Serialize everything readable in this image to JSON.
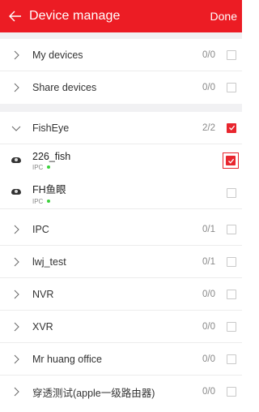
{
  "header": {
    "title": "Device manage",
    "done_label": "Done"
  },
  "groups_top": [
    {
      "label": "My devices",
      "count": "0/0",
      "checked": false
    },
    {
      "label": "Share devices",
      "count": "0/0",
      "checked": false
    }
  ],
  "fisheye": {
    "label": "FishEye",
    "count": "2/2",
    "checked": true,
    "devices": [
      {
        "name": "226_fish",
        "type": "IPC",
        "online_color": "#3bd13b",
        "checked": true
      },
      {
        "name": "FH鱼眼",
        "type": "IPC",
        "online_color": "#3bd13b",
        "checked": false
      }
    ]
  },
  "groups_bottom": [
    {
      "label": "IPC",
      "count": "0/1",
      "checked": false
    },
    {
      "label": "lwj_test",
      "count": "0/1",
      "checked": false
    },
    {
      "label": "NVR",
      "count": "0/0",
      "checked": false
    },
    {
      "label": "XVR",
      "count": "0/0",
      "checked": false
    },
    {
      "label": "Mr huang office",
      "count": "0/0",
      "checked": false
    },
    {
      "label": "穿透测试(apple一级路由器)",
      "count": "0/0",
      "checked": false
    }
  ],
  "colors": {
    "accent": "#ec1c24",
    "online": "#3bd13b"
  }
}
